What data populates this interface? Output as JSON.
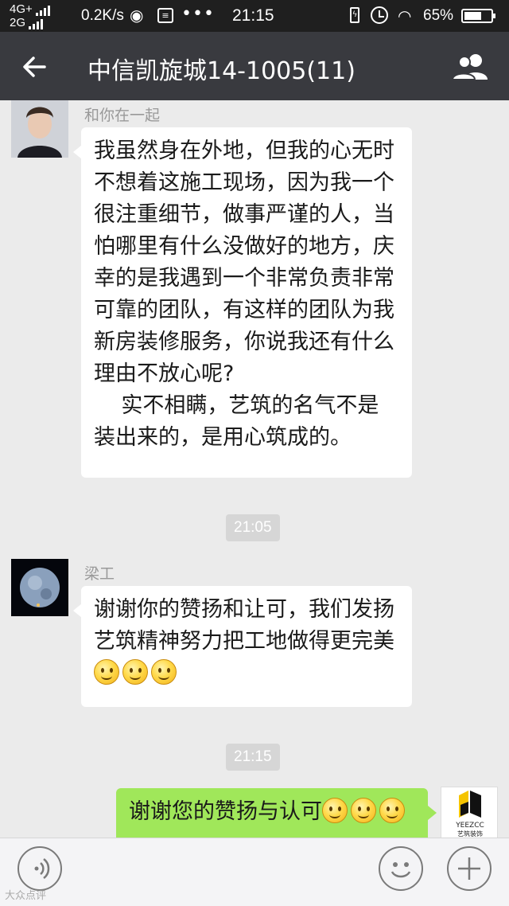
{
  "status_bar": {
    "network_top": "4G+",
    "network_bottom": "2G",
    "speed": "0.2K/s",
    "time": "21:15",
    "battery_percent": "65%",
    "battery_level": 0.65,
    "icons": [
      "signal-icon",
      "weibo-icon",
      "notification-icon",
      "more-icon",
      "charging-icon",
      "alarm-icon",
      "wifi-icon",
      "battery-icon"
    ]
  },
  "header": {
    "title": "中信凯旋城14-1005(11)",
    "icons": [
      "back-arrow-icon",
      "group-members-icon"
    ]
  },
  "messages": [
    {
      "sender": "和你在一起",
      "side": "left",
      "text": "我虽然身在外地，但我的心无时不想着这施工现场，因为我一个很注重细节，做事严谨的人，当怕哪里有什么没做好的地方，庆幸的是我遇到一个非常负责非常可靠的团队，有这样的团队为我新房装修服务，你说我还有什么理由不放心呢?\n    实不相瞒，艺筑的名气不是装出来的，是用心筑成的。"
    },
    {
      "time": "21:05"
    },
    {
      "sender": "梁工",
      "side": "left",
      "text": "谢谢你的赞扬和让可，我们发扬艺筑精神努力把工地做得更完美",
      "emoji_count": 3
    },
    {
      "time": "21:15"
    },
    {
      "side": "right",
      "text": "谢谢您的赞扬与认可",
      "emoji_count": 3,
      "avatar_logo": "YEEZCC",
      "avatar_logo_cn": "艺筑装饰"
    }
  ],
  "input_bar": {
    "icons": [
      "voice-icon",
      "emoji-icon",
      "plus-icon"
    ]
  },
  "watermark": "大众点评"
}
